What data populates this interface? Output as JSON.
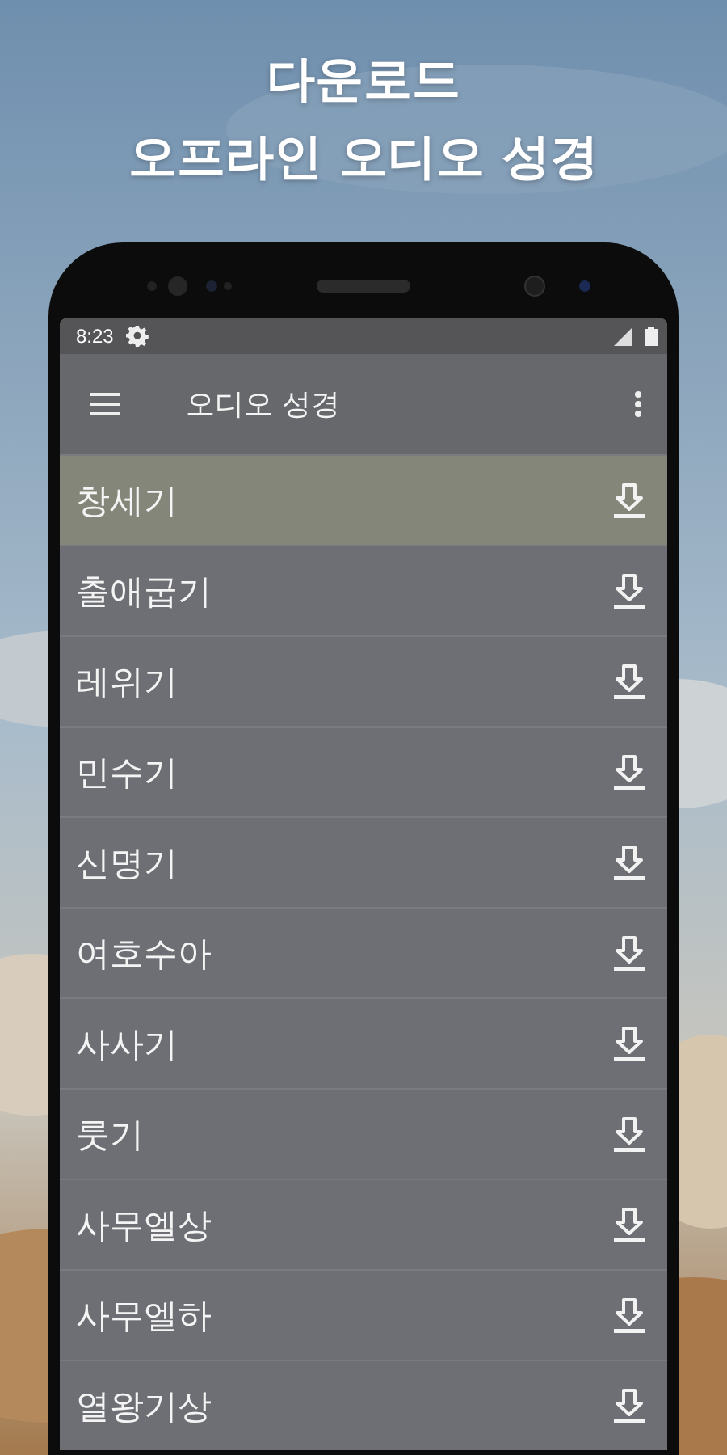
{
  "headline": [
    "다운로드",
    "오프라인 오디오 성경"
  ],
  "status_bar": {
    "time": "8:23"
  },
  "app_bar": {
    "title": "오디오 성경"
  },
  "books": [
    {
      "name": "창세기",
      "selected": true
    },
    {
      "name": "출애굽기",
      "selected": false
    },
    {
      "name": "레위기",
      "selected": false
    },
    {
      "name": "민수기",
      "selected": false
    },
    {
      "name": "신명기",
      "selected": false
    },
    {
      "name": "여호수아",
      "selected": false
    },
    {
      "name": "사사기",
      "selected": false
    },
    {
      "name": "룻기",
      "selected": false
    },
    {
      "name": "사무엘상",
      "selected": false
    },
    {
      "name": "사무엘하",
      "selected": false
    },
    {
      "name": "열왕기상",
      "selected": false
    }
  ]
}
